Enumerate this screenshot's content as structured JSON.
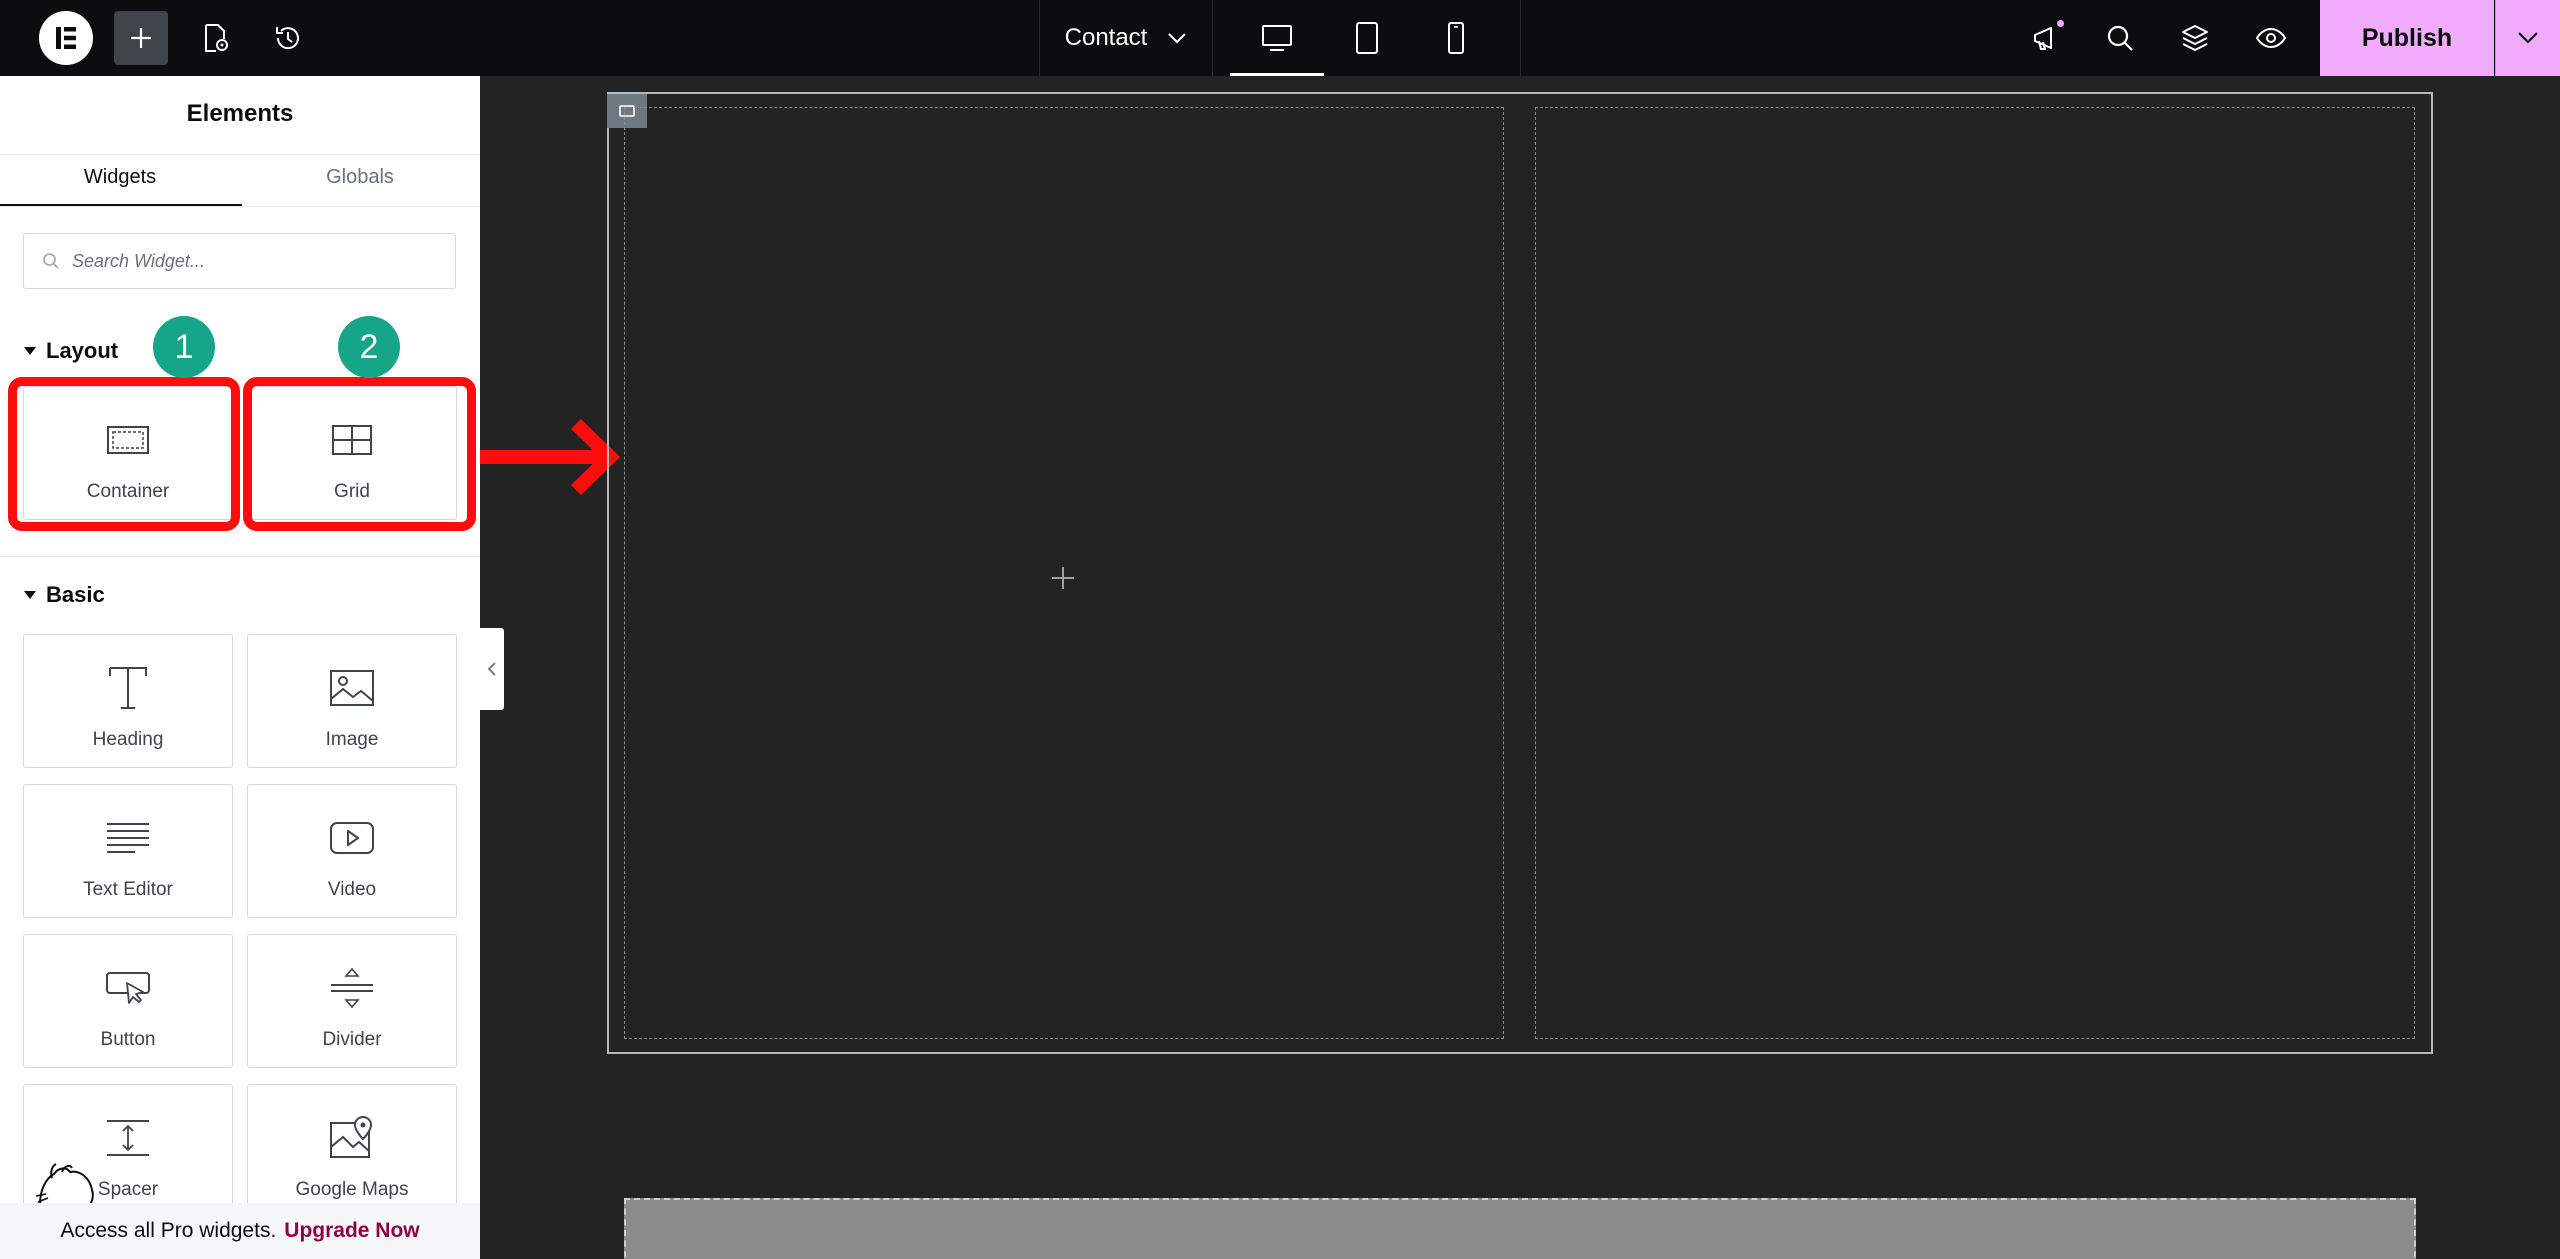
{
  "topbar": {
    "page_name": "Contact",
    "publish_label": "Publish"
  },
  "panel": {
    "title": "Elements",
    "tabs": [
      {
        "label": "Widgets",
        "active": true
      },
      {
        "label": "Globals",
        "active": false
      }
    ],
    "search_placeholder": "Search Widget...",
    "categories": {
      "layout": {
        "title": "Layout",
        "widgets": [
          {
            "label": "Container",
            "icon": "container-icon"
          },
          {
            "label": "Grid",
            "icon": "grid-icon"
          }
        ]
      },
      "basic": {
        "title": "Basic",
        "widgets": [
          {
            "label": "Heading",
            "icon": "heading-icon"
          },
          {
            "label": "Image",
            "icon": "image-icon"
          },
          {
            "label": "Text Editor",
            "icon": "text-editor-icon"
          },
          {
            "label": "Video",
            "icon": "video-icon"
          },
          {
            "label": "Button",
            "icon": "button-icon"
          },
          {
            "label": "Divider",
            "icon": "divider-icon"
          },
          {
            "label": "Spacer",
            "icon": "spacer-icon"
          },
          {
            "label": "Google Maps",
            "icon": "google-maps-icon"
          }
        ]
      }
    },
    "pro_banner": {
      "text": "Access all Pro widgets.",
      "link": "Upgrade Now"
    }
  },
  "annotations": {
    "badge_1": "1",
    "badge_2": "2",
    "highlight_color": "#ff0d0d",
    "badge_color": "#17a589"
  },
  "colors": {
    "topbar_bg": "#0c0d0e",
    "publish_bg": "#f0abfc",
    "canvas_bg": "#232323"
  }
}
